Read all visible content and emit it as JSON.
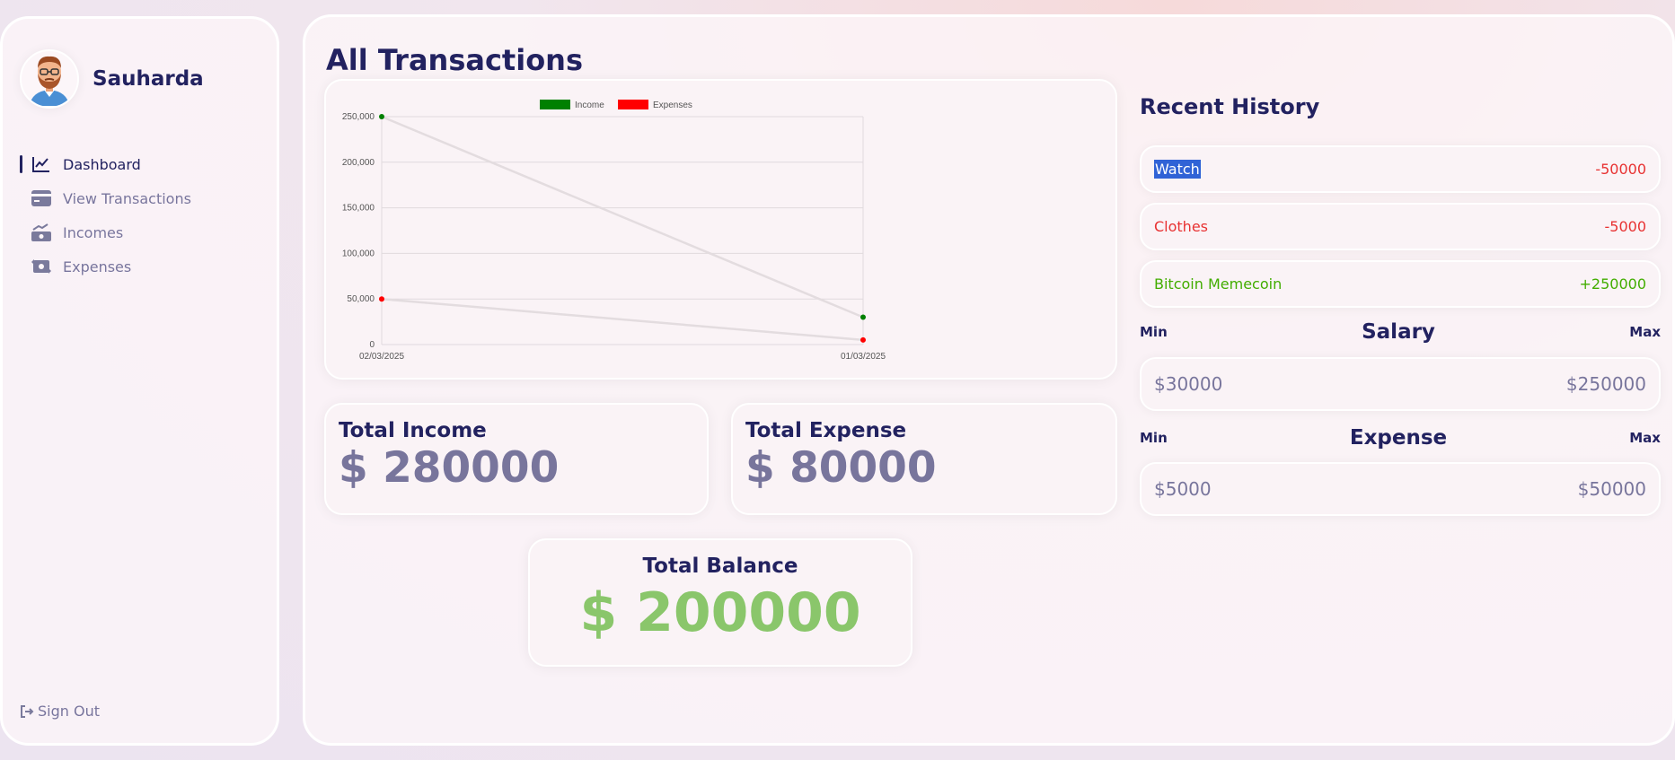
{
  "profile": {
    "name": "Sauharda"
  },
  "menu": {
    "items": [
      {
        "label": "Dashboard",
        "icon": "chart-line-icon"
      },
      {
        "label": "View Transactions",
        "icon": "credit-card-icon"
      },
      {
        "label": "Incomes",
        "icon": "money-bill-trend-up-icon"
      },
      {
        "label": "Expenses",
        "icon": "money-bill-transfer-icon"
      }
    ],
    "active": "Dashboard"
  },
  "signout": {
    "label": "Sign Out",
    "icon": "sign-out-icon"
  },
  "page": {
    "title": "All Transactions"
  },
  "chart_data": {
    "type": "line",
    "categories": [
      "02/03/2025",
      "01/03/2025"
    ],
    "series": [
      {
        "name": "Income",
        "values": [
          250000,
          30000
        ],
        "color": "#008000"
      },
      {
        "name": "Expenses",
        "values": [
          50000,
          5000
        ],
        "color": "#ff0000"
      }
    ],
    "yticks": [
      "250,000",
      "200,000",
      "150,000",
      "100,000",
      "50,000",
      "0"
    ],
    "ylim": [
      0,
      250000
    ],
    "grid": true,
    "legend_position": "top"
  },
  "totals": {
    "income_title": "Total Income",
    "income_value": "$ 280000",
    "expense_title": "Total Expense",
    "expense_value": "$ 80000",
    "balance_title": "Total Balance",
    "balance_value": "$ 200000"
  },
  "history": {
    "title": "Recent History",
    "items": [
      {
        "name": "Watch",
        "amount": "-50000"
      },
      {
        "name": "Clothes",
        "amount": "-5000"
      },
      {
        "name": "Bitcoin Memecoin",
        "amount": "+250000"
      }
    ]
  },
  "salary": {
    "title": "Salary",
    "min_label": "Min",
    "max_label": "Max",
    "min": "$30000",
    "max": "$250000"
  },
  "expense_range": {
    "title": "Expense",
    "min_label": "Min",
    "max_label": "Max",
    "min": "$5000",
    "max": "$50000"
  }
}
